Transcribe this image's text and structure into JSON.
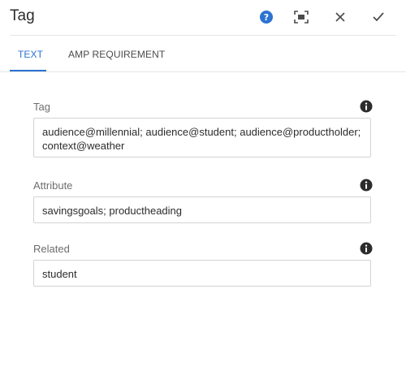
{
  "dialog": {
    "title": "Tag",
    "actions": {
      "help": "help-icon",
      "fullscreen": "fullscreen-icon",
      "close": "close-icon",
      "done": "checkmark-icon"
    }
  },
  "tabs": [
    {
      "label": "TEXT",
      "active": true
    },
    {
      "label": "AMP REQUIREMENT",
      "active": false
    }
  ],
  "fields": {
    "tag": {
      "label": "Tag",
      "value": "audience@millennial; audience@student; audience@productholder; context@weather"
    },
    "attribute": {
      "label": "Attribute",
      "value": "savingsgoals; productheading"
    },
    "related": {
      "label": "Related",
      "value": "student"
    }
  },
  "colors": {
    "accent": "#2c73d2",
    "help_icon": "#2c73d2",
    "info_icon": "#2c2c2c"
  }
}
